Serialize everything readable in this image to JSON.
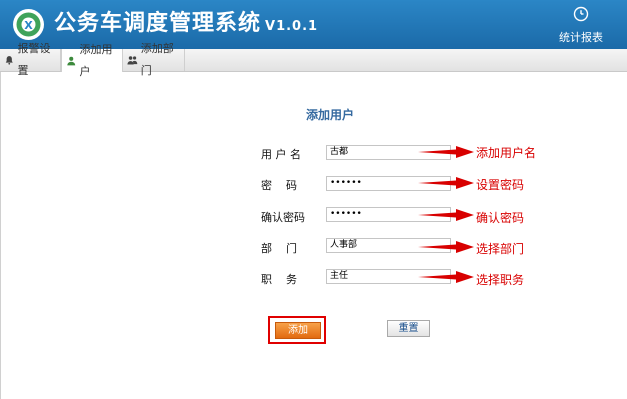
{
  "app": {
    "title": "公务车调度管理系统",
    "version": "V1.0.1",
    "stats_label": "统计报表",
    "stats_icon": "clock-icon",
    "logo_icon": "car-logo-icon"
  },
  "tabs": [
    {
      "label": "报警设置",
      "icon": "bell-icon",
      "active": false
    },
    {
      "label": "添加用户",
      "icon": "user-icon",
      "active": true
    },
    {
      "label": "添加部门",
      "icon": "users-icon",
      "active": false
    }
  ],
  "form": {
    "title": "添加用户",
    "fields": [
      {
        "label": "用 户 名",
        "value": "古都",
        "annotation": "添加用户名"
      },
      {
        "label": "密    码",
        "value": "••••••",
        "annotation": "设置密码"
      },
      {
        "label": "确认密码",
        "value": "••••••",
        "annotation": "确认密码"
      },
      {
        "label": "部    门",
        "value": "人事部",
        "annotation": "选择部门"
      },
      {
        "label": "职    务",
        "value": "主任",
        "annotation": "选择职务"
      }
    ],
    "add_button": "添加",
    "reset_button": "重置"
  },
  "colors": {
    "header": "#1f74b5",
    "annotation": "#d80000",
    "highlight_box": "#e00000",
    "add_button": "#ee8123"
  }
}
